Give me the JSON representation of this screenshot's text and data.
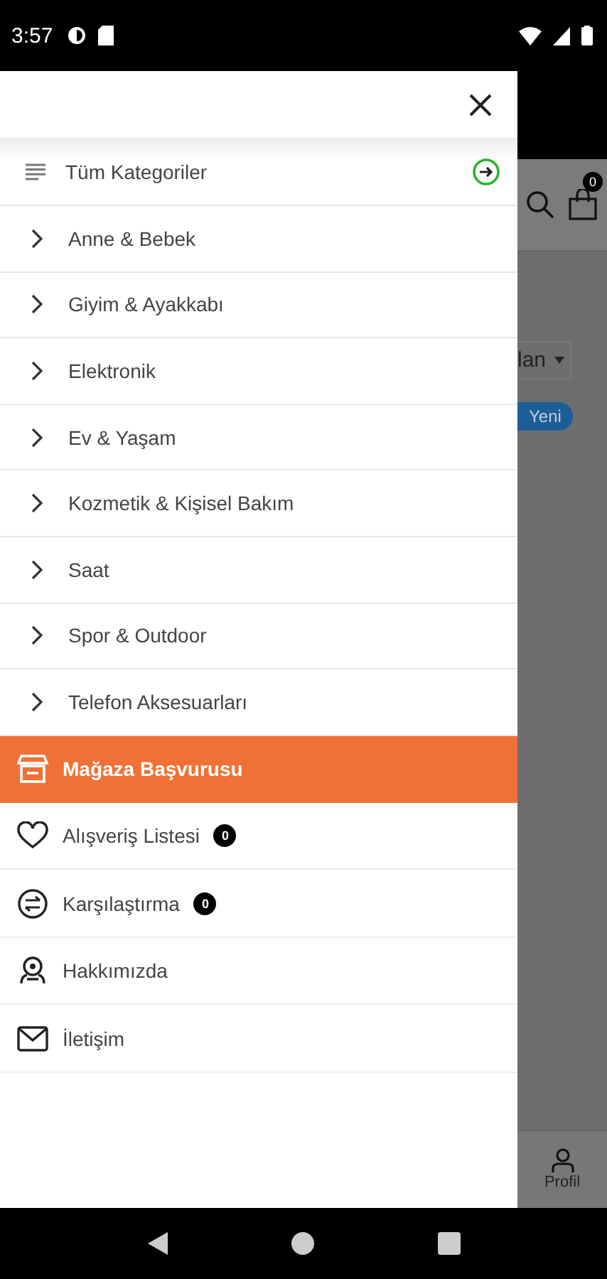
{
  "status_bar": {
    "time": "3:57"
  },
  "drawer": {
    "all_categories": "Tüm Kategoriler",
    "categories": [
      "Anne & Bebek",
      "Giyim & Ayakkabı",
      "Elektronik",
      "Ev & Yaşam",
      "Kozmetik & Kişisel Bakım",
      "Saat",
      "Spor & Outdoor",
      "Telefon Aksesuarları"
    ],
    "store_application": "Mağaza Başvurusu",
    "links": [
      {
        "kind": "heart",
        "label": "Alışveriş Listesi",
        "count": "0"
      },
      {
        "kind": "compare",
        "label": "Karşılaştırma",
        "count": "0"
      },
      {
        "kind": "about",
        "label": "Hakkımızda"
      },
      {
        "kind": "mail",
        "label": "İletişim"
      }
    ]
  },
  "background": {
    "cart_count": "0",
    "sort_field": "lan",
    "badge": "Yeni",
    "nav_label": "Profil"
  }
}
